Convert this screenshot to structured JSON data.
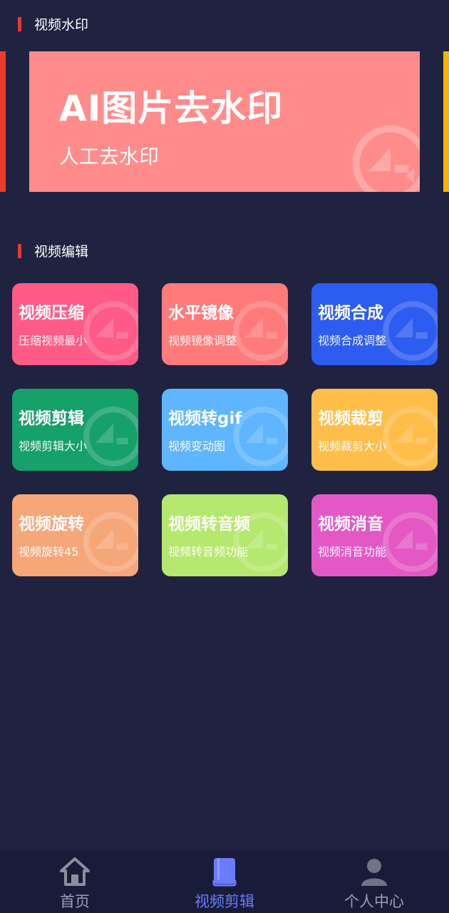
{
  "sections": {
    "watermark": "视频水印",
    "edit": "视频编辑"
  },
  "banner": {
    "title": "AI图片去水印",
    "subtitle": "人工去水印",
    "background": "#ff8b8b",
    "left_peek_color": "#ee3b2b",
    "right_peek_color": "#f4b400"
  },
  "tools": [
    {
      "title": "视频压缩",
      "subtitle": "压缩视频最小",
      "color": "#ff5b86"
    },
    {
      "title": "水平镜像",
      "subtitle": "视频镜像调整",
      "color": "#ff7b7b"
    },
    {
      "title": "视频合成",
      "subtitle": "视频合成调整",
      "color": "#2d5cf0"
    },
    {
      "title": "视频剪辑",
      "subtitle": "视频剪辑大小",
      "color": "#16a06a"
    },
    {
      "title": "视频转gif",
      "subtitle": "视频变动图",
      "color": "#5fb6ff"
    },
    {
      "title": "视频裁剪",
      "subtitle": "视频裁剪大小",
      "color": "#ffbd4a"
    },
    {
      "title": "视频旋转",
      "subtitle": "视频旋转45",
      "color": "#f6a77a"
    },
    {
      "title": "视频转音频",
      "subtitle": "视频转音频功能",
      "color": "#b5e86e"
    },
    {
      "title": "视频消音",
      "subtitle": "视频消音功能",
      "color": "#e358c4"
    }
  ],
  "nav": {
    "items": [
      {
        "label": "首页",
        "icon": "home-icon",
        "active": false
      },
      {
        "label": "视频剪辑",
        "icon": "book-icon",
        "active": true
      },
      {
        "label": "个人中心",
        "icon": "user-icon",
        "active": false
      }
    ],
    "active_color": "#6b7bff",
    "inactive_color": "#9aa0b3"
  }
}
